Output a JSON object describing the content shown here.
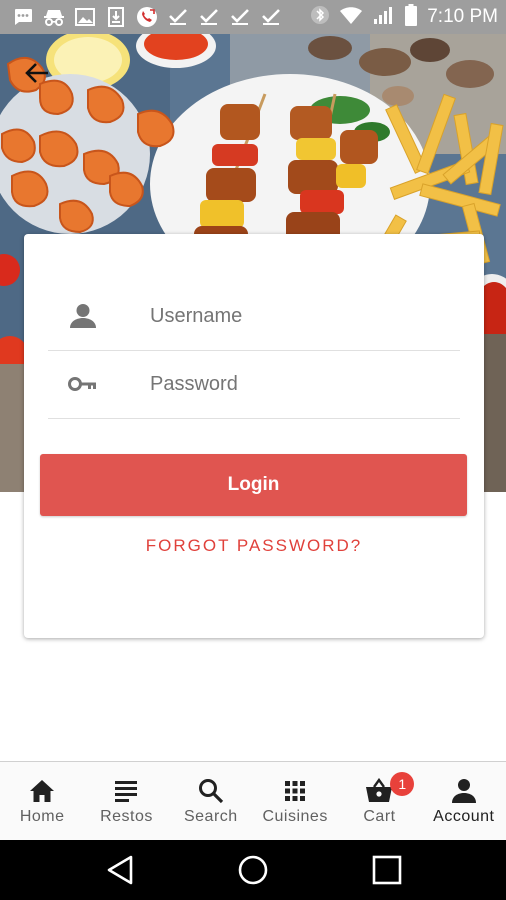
{
  "status_bar": {
    "time": "7:10 PM",
    "left_icons": [
      "message-icon",
      "incognito-icon",
      "image-icon",
      "download-icon",
      "missed-call-icon",
      "check-icon",
      "check-icon",
      "check-icon",
      "check-icon"
    ],
    "right_icons": [
      "bluetooth-icon",
      "wifi-icon",
      "signal-icon",
      "battery-icon"
    ]
  },
  "hero": {
    "image": "food-platter-photo",
    "back_icon": "back-arrow-icon"
  },
  "login_form": {
    "username": {
      "placeholder": "Username",
      "value": "",
      "icon": "person-icon"
    },
    "password": {
      "placeholder": "Password",
      "value": "",
      "icon": "key-icon"
    },
    "login_label": "Login",
    "forgot_label": "FORGOT PASSWORD?"
  },
  "bottom_nav": {
    "items": [
      {
        "label": "Home",
        "icon": "home-icon"
      },
      {
        "label": "Restos",
        "icon": "list-icon"
      },
      {
        "label": "Search",
        "icon": "search-icon"
      },
      {
        "label": "Cuisines",
        "icon": "grid-icon"
      },
      {
        "label": "Cart",
        "icon": "basket-icon",
        "badge": "1"
      },
      {
        "label": "Account",
        "icon": "person-icon",
        "active": true
      }
    ]
  },
  "system_nav": {
    "buttons": [
      "back-triangle-icon",
      "home-circle-icon",
      "recents-square-icon"
    ]
  },
  "colors": {
    "accent": "#e05550",
    "link": "#e0413b",
    "badge": "#e8413b",
    "status_bar": "#9e9e9e"
  }
}
